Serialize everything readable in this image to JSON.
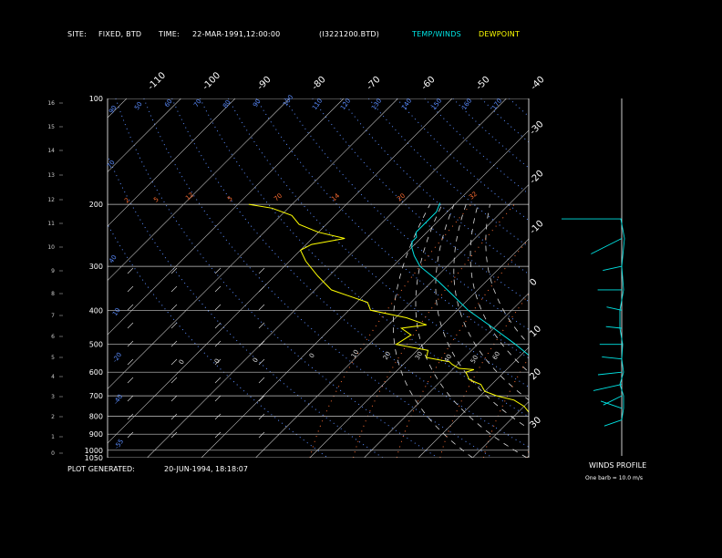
{
  "header": {
    "site_label": "SITE:",
    "site_value": "FIXED, BTD",
    "time_label": "TIME:",
    "time_value": "22-MAR-1991,12:00:00",
    "file_id": "(I3221200.BTD)",
    "legend_temp": "TEMP/WINDS",
    "legend_dew": "DEWPOINT"
  },
  "footer": {
    "generated_label": "PLOT GENERATED:",
    "generated_value": "20-JUN-1994, 18:18:07",
    "winds_title": "WINDS PROFILE",
    "winds_note": "One barb = 10.0 m/s"
  },
  "colors": {
    "temperature": "#00e5e5",
    "dewpoint": "#ffff00",
    "isobar": "#c8c8c8",
    "isotherm": "#c8c8c8",
    "dry_adiabat": "#5a8cff",
    "mixing_ratio": "#ff6e32",
    "moist_adiabat": "#dcdcdc",
    "wind": "#00e5e5",
    "km_tick": "#aaaaaa"
  },
  "chart_data": {
    "type": "line",
    "subtype": "skew-T log-P diagram",
    "pressure_levels": [
      100,
      200,
      300,
      400,
      500,
      600,
      700,
      800,
      900,
      1000,
      1050
    ],
    "pressure_tick_labels": [
      "100",
      "200",
      "300",
      "400",
      "500",
      "600",
      "700",
      "800",
      "900",
      "1000",
      "1050"
    ],
    "height_km_labels": [
      "0",
      "1",
      "2",
      "3",
      "4",
      "5",
      "6",
      "7",
      "8",
      "9",
      "10",
      "11",
      "12",
      "13",
      "14",
      "15",
      "16"
    ],
    "isotherm_top_labels": [
      "-110",
      "-100",
      "-90",
      "-80",
      "-70",
      "-60",
      "-50",
      "-40"
    ],
    "isotherm_right_labels": [
      "-30",
      "-20",
      "-10",
      "0",
      "10",
      "20",
      "30"
    ],
    "dry_adiabat_labels": [
      "90",
      "50",
      "60",
      "70",
      "80",
      "90",
      "100",
      "110",
      "120",
      "130",
      "140",
      "150",
      "160",
      "170"
    ],
    "mixing_ratio_labels": [
      "2",
      "5",
      "12",
      "5",
      "70",
      "14",
      "20",
      "32"
    ],
    "moist_adiabat_labels": [
      "0",
      "0",
      "0",
      "0",
      "10",
      "20",
      "30",
      "40",
      "50",
      "60"
    ],
    "ylim": [
      1050,
      100
    ],
    "series": [
      {
        "name": "TEMP/WINDS",
        "pressure": [
          810,
          800,
          780,
          770,
          760,
          740,
          720,
          700,
          680,
          650,
          620,
          600,
          580,
          550,
          500,
          450,
          400,
          360,
          330,
          300,
          280,
          265,
          255,
          248,
          240,
          230,
          222,
          210,
          198
        ],
        "temperature_c": [
          4,
          5,
          6,
          7,
          6,
          3,
          0,
          -1,
          -3,
          -6,
          -9,
          -10,
          -12,
          -17,
          -23,
          -30,
          -38,
          -44,
          -49,
          -55,
          -58,
          -60,
          -61,
          -61,
          -62,
          -62,
          -62,
          -62,
          -63
        ]
      },
      {
        "name": "DEWPOINT",
        "pressure": [
          820,
          810,
          800,
          780,
          750,
          720,
          700,
          680,
          650,
          630,
          600,
          590,
          585,
          570,
          560,
          545,
          520,
          500,
          470,
          450,
          440,
          420,
          400,
          380,
          350,
          320,
          290,
          270,
          260,
          250,
          240,
          228,
          215,
          205,
          200
        ],
        "dewpoint_c": [
          -5,
          -3,
          -6,
          -8,
          -10,
          -13,
          -17,
          -20,
          -22,
          -25,
          -27,
          -26,
          -29,
          -31,
          -32,
          -37,
          -38,
          -45,
          -44,
          -47,
          -43,
          -48,
          -56,
          -58,
          -67,
          -72,
          -77,
          -80,
          -79,
          -74,
          -80,
          -85,
          -88,
          -93,
          -98
        ]
      }
    ],
    "wind_profile": [
      {
        "pressure": 820,
        "direction": 240,
        "speed": 10
      },
      {
        "pressure": 760,
        "direction": 300,
        "speed": 12
      },
      {
        "pressure": 700,
        "direction": 230,
        "speed": 12
      },
      {
        "pressure": 650,
        "direction": 250,
        "speed": 15
      },
      {
        "pressure": 600,
        "direction": 260,
        "speed": 12
      },
      {
        "pressure": 550,
        "direction": 280,
        "speed": 10
      },
      {
        "pressure": 500,
        "direction": 270,
        "speed": 11
      },
      {
        "pressure": 450,
        "direction": 280,
        "speed": 8
      },
      {
        "pressure": 400,
        "direction": 290,
        "speed": 8
      },
      {
        "pressure": 350,
        "direction": 270,
        "speed": 12
      },
      {
        "pressure": 300,
        "direction": 250,
        "speed": 10
      },
      {
        "pressure": 250,
        "direction": 230,
        "speed": 20
      },
      {
        "pressure": 220,
        "direction": 270,
        "speed": 30
      }
    ]
  }
}
